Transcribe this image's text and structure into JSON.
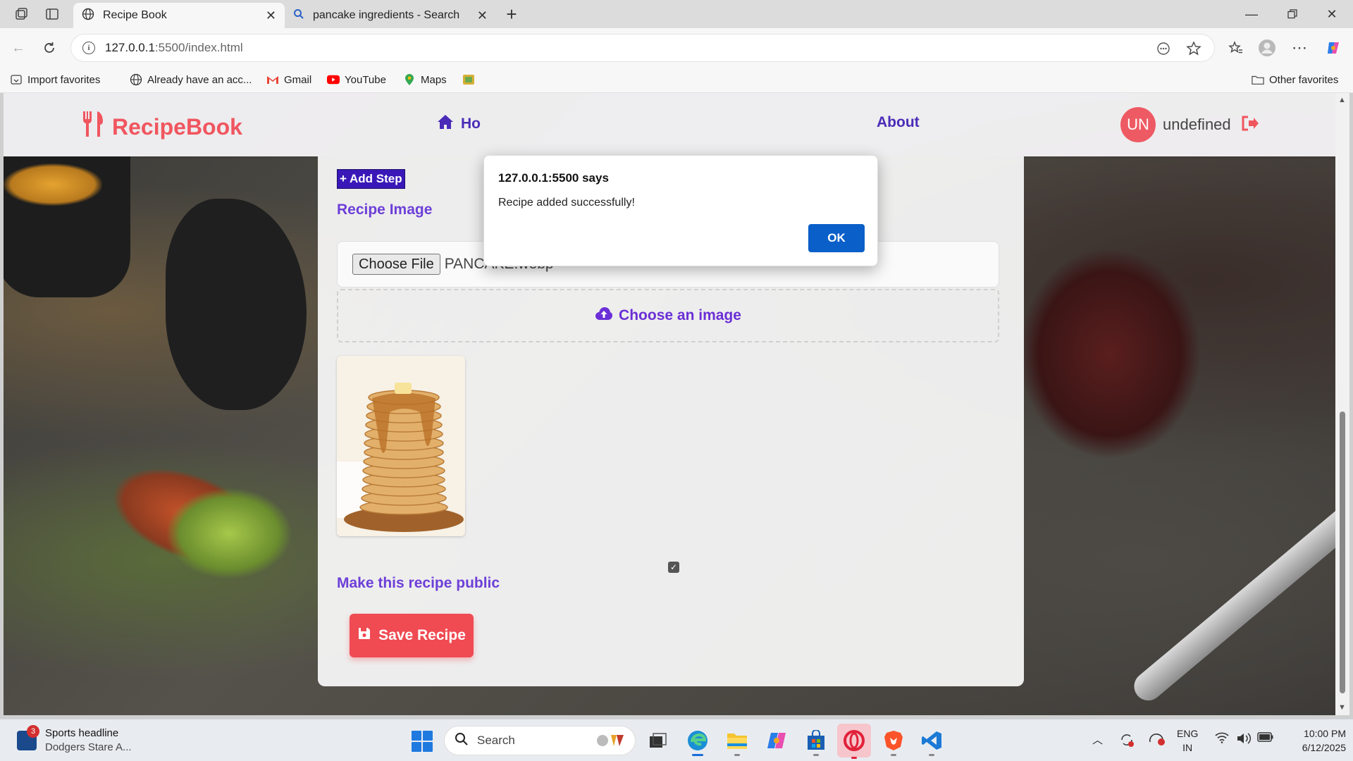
{
  "browser": {
    "tabs": [
      {
        "label": "Recipe Book",
        "icon": "globe-icon",
        "active": true
      },
      {
        "label": "pancake ingredients - Search",
        "icon": "search-icon",
        "active": false
      }
    ],
    "url_host": "127.0.0.1",
    "url_path": ":5500/index.html",
    "favorites": [
      {
        "label": "Import favorites",
        "icon": "import-icon"
      },
      {
        "label": "Already have an acc...",
        "icon": "globe-icon"
      },
      {
        "label": "Gmail",
        "icon": "gmail-icon"
      },
      {
        "label": "YouTube",
        "icon": "youtube-icon"
      },
      {
        "label": "Maps",
        "icon": "maps-icon"
      }
    ],
    "other_favorites": "Other favorites"
  },
  "header": {
    "brand": "RecipeBook",
    "nav_home": "Ho",
    "nav_about": "About",
    "avatar_initials": "UN",
    "username": "undefined"
  },
  "form": {
    "add_step_label": "+ Add Step",
    "image_section_label": "Recipe Image",
    "choose_file_label": "Choose File",
    "file_name": "PANCAKE.webp",
    "dropzone_label": "Choose an image",
    "public_label": "Make this recipe public",
    "public_checked": true,
    "save_label": "Save Recipe"
  },
  "alert": {
    "title": "127.0.0.1:5500 says",
    "message": "Recipe added successfully!",
    "ok_label": "OK"
  },
  "taskbar": {
    "news_badge": "3",
    "news_headline": "Sports headline",
    "news_sub": "Dodgers Stare A...",
    "search_placeholder": "Search",
    "lang_top": "ENG",
    "lang_bottom": "IN",
    "time": "10:00 PM",
    "date": "6/12/2025"
  },
  "colors": {
    "brand": "#f0565f",
    "nav": "#4a2bb8",
    "accent_purple": "#6d3fd8",
    "ok_button": "#0a5fc9"
  }
}
